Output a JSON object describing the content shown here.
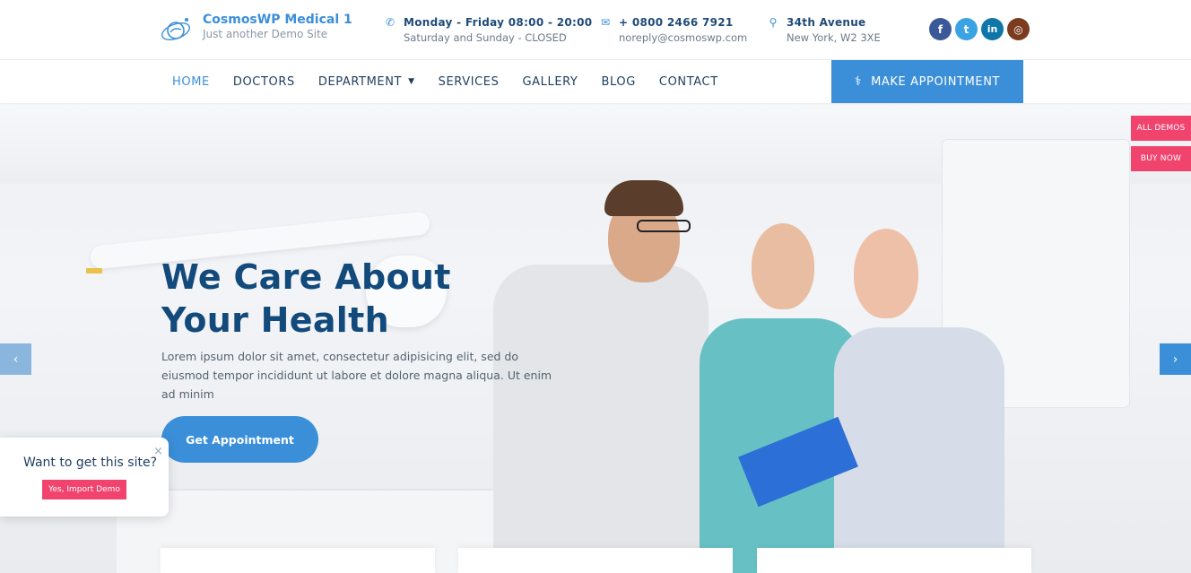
{
  "header": {
    "brand_title": "CosmosWP Medical 1",
    "brand_tagline": "Just another Demo Site",
    "hours": {
      "line1": "Monday - Friday 08:00 - 20:00",
      "line2": "Saturday and Sunday - CLOSED",
      "icon": "phone-icon"
    },
    "contact": {
      "line1": "+ 0800 2466 7921",
      "line2": "noreply@cosmoswp.com",
      "icon": "mail-icon"
    },
    "address": {
      "line1": "34th Avenue",
      "line2": "New York, W2 3XE",
      "icon": "map-pin-icon"
    },
    "socials": [
      {
        "name": "facebook",
        "glyph": "f",
        "color": "#3b5998"
      },
      {
        "name": "twitter",
        "glyph": "t",
        "color": "#3aa3e3"
      },
      {
        "name": "linkedin",
        "glyph": "in",
        "color": "#0e76a8"
      },
      {
        "name": "instagram",
        "glyph": "◎",
        "color": "#7a3b1e"
      }
    ]
  },
  "nav": {
    "items": [
      "HOME",
      "DOCTORS",
      "DEPARTMENT",
      "SERVICES",
      "GALLERY",
      "BLOG",
      "CONTACT"
    ],
    "active": "HOME",
    "appointment_label": "MAKE APPOINTMENT"
  },
  "hero": {
    "title_line1": "We Care About",
    "title_line2": "Your Health",
    "text": "Lorem ipsum dolor sit amet, consectetur adipisicing elit, sed do eiusmod tempor incididunt ut labore et dolore magna aliqua. Ut enim ad minim",
    "button_label": "Get Appointment"
  },
  "side_tabs": {
    "all_demos": "ALL DEMOS",
    "buy_now": "BUY NOW"
  },
  "popup": {
    "question": "Want to get this site?",
    "button_label": "Yes, Import Demo",
    "close": "×"
  },
  "colors": {
    "accent": "#3b8fd9",
    "heading": "#134a7c",
    "pink": "#f0446f"
  }
}
